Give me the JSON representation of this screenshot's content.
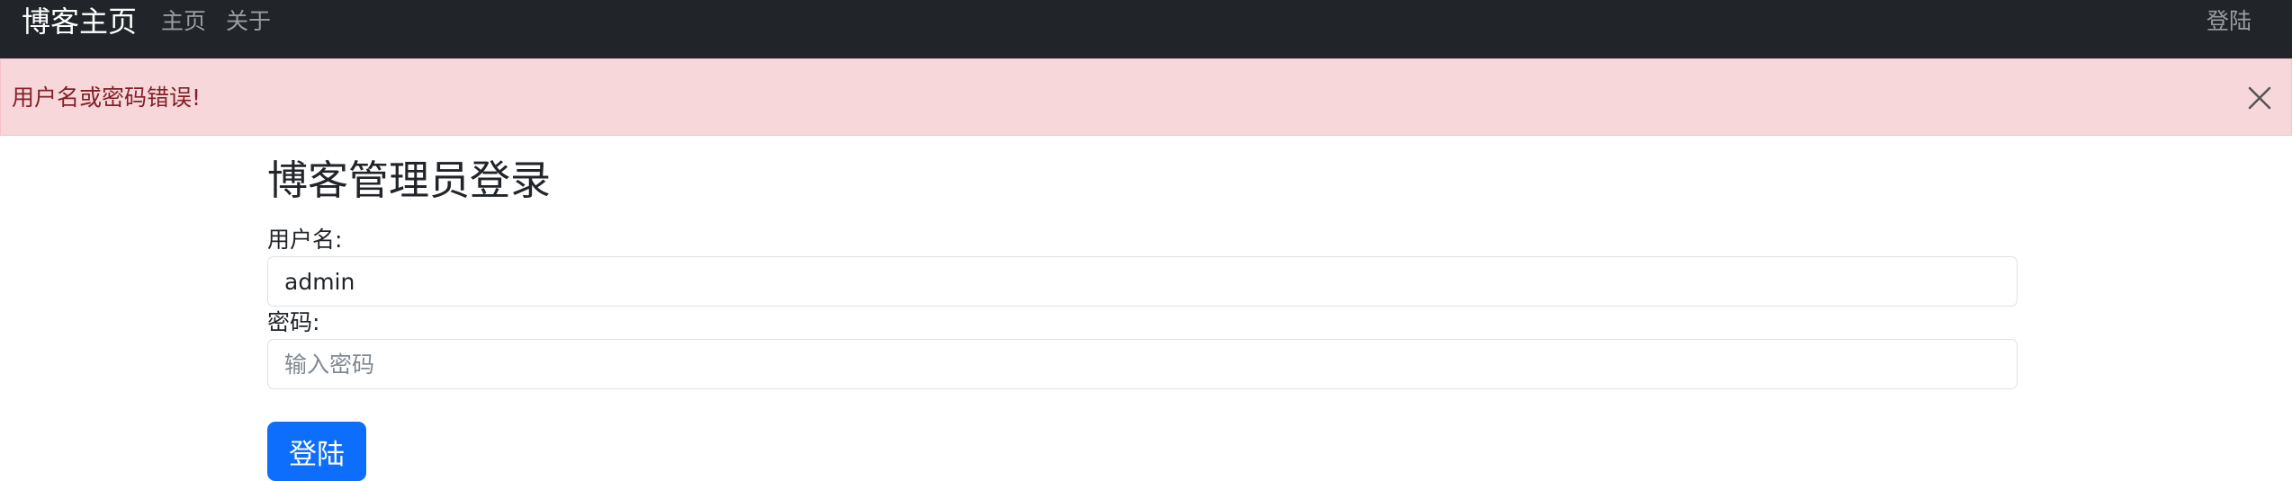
{
  "navbar": {
    "brand": "博客主页",
    "links": [
      {
        "label": "主页"
      },
      {
        "label": "关于"
      }
    ],
    "login_label": "登陆"
  },
  "alert": {
    "message": "用户名或密码错误!",
    "close_icon": "close-icon"
  },
  "form": {
    "title": "博客管理员登录",
    "username_label": "用户名:",
    "username_value": "admin",
    "password_label": "密码:",
    "password_value": "",
    "password_placeholder": "输入密码",
    "submit_label": "登陆"
  },
  "colors": {
    "navbar_bg": "#212529",
    "alert_bg": "#f8d7da",
    "alert_text": "#842029",
    "primary": "#0d6efd"
  }
}
